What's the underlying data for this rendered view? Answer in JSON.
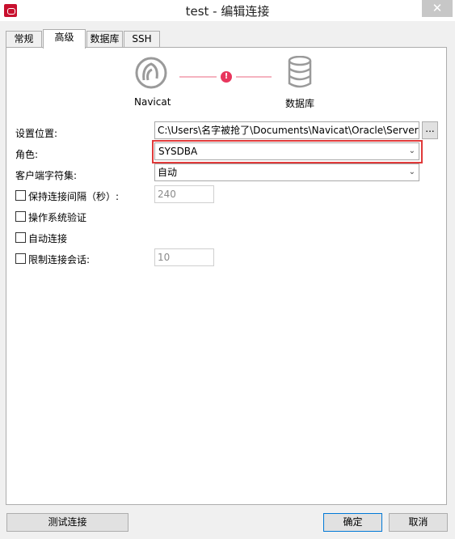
{
  "window": {
    "title": "test - 编辑连接",
    "close_glyph": "✕"
  },
  "tabs": [
    {
      "label": "常规",
      "active": false
    },
    {
      "label": "高级",
      "active": true
    },
    {
      "label": "数据库",
      "active": false
    },
    {
      "label": "SSH",
      "active": false
    }
  ],
  "diagram": {
    "left_icon": "navicat-logo-icon",
    "left_label": "Navicat",
    "status_icon": "error-icon",
    "status_glyph": "!",
    "right_icon": "database-icon",
    "right_label": "数据库",
    "accent_color": "#e8365d"
  },
  "form": {
    "location_label": "设置位置:",
    "location_value": "C:\\Users\\名字被抢了\\Documents\\Navicat\\Oracle\\Servers",
    "browse_label": "...",
    "role_label": "角色:",
    "role_value": "SYSDBA",
    "charset_label": "客户端字符集:",
    "charset_value": "自动",
    "keepalive_label": "保持连接间隔（秒）:",
    "keepalive_value": "240",
    "keepalive_checked": false,
    "os_auth_label": "操作系统验证",
    "os_auth_checked": false,
    "auto_connect_label": "自动连接",
    "auto_connect_checked": false,
    "limit_sessions_label": "限制连接会话:",
    "limit_sessions_value": "10",
    "limit_sessions_checked": false
  },
  "footer": {
    "test_button": "测试连接",
    "ok_button": "确定",
    "cancel_button": "取消"
  },
  "highlight_color": "#e03a3a"
}
